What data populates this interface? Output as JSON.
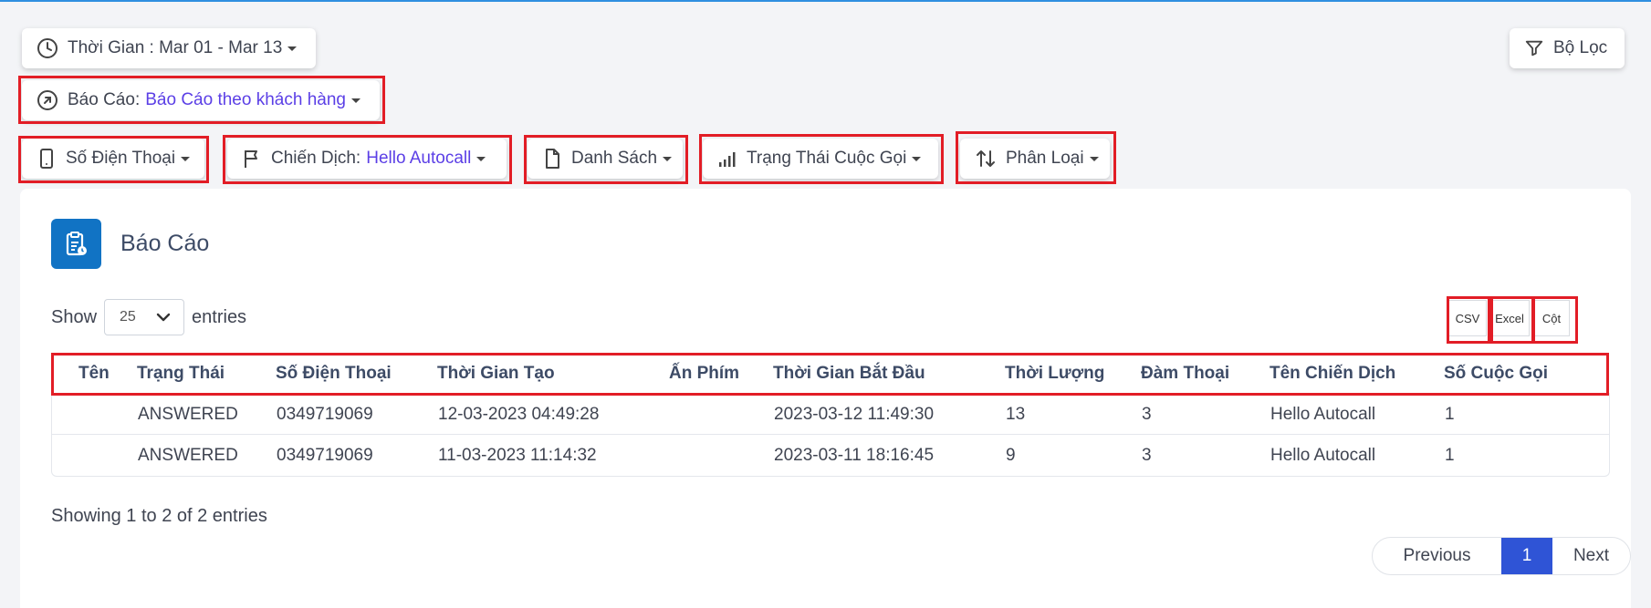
{
  "filters": {
    "time": {
      "label": "Thời Gian : Mar 01 - Mar 13"
    },
    "report": {
      "label": "Báo Cáo:",
      "value": "Báo Cáo theo khách hàng"
    },
    "phone": {
      "label": "Số Điện Thoại"
    },
    "campaign": {
      "label": "Chiến Dịch:",
      "value": "Hello Autocall"
    },
    "list": {
      "label": "Danh Sách"
    },
    "call_status": {
      "label": "Trạng Thái Cuộc Gọi"
    },
    "category": {
      "label": "Phân Loại"
    },
    "filter_button": {
      "label": "Bộ Lọc"
    }
  },
  "report": {
    "title": "Báo Cáo",
    "show_label": "Show",
    "page_size": "25",
    "entries_label": "entries",
    "export": {
      "csv": "CSV",
      "excel": "Excel",
      "columns": "Cột"
    },
    "columns": [
      "Tên",
      "Trạng Thái",
      "Số Điện Thoại",
      "Thời Gian Tạo",
      "Ấn Phím",
      "Thời Gian Bắt Đầu",
      "Thời Lượng",
      "Đàm Thoại",
      "Tên Chiến Dịch",
      "Số Cuộc Gọi"
    ],
    "rows": [
      [
        "",
        "ANSWERED",
        "0349719069",
        "12-03-2023 04:49:28",
        "",
        "2023-03-12 11:49:30",
        "13",
        "3",
        "Hello Autocall",
        "1"
      ],
      [
        "",
        "ANSWERED",
        "0349719069",
        "11-03-2023 11:14:32",
        "",
        "2023-03-11 18:16:45",
        "9",
        "3",
        "Hello Autocall",
        "1"
      ]
    ],
    "info": "Showing 1 to 2 of 2 entries",
    "pagination": {
      "previous": "Previous",
      "current": "1",
      "next": "Next"
    }
  },
  "colors": {
    "accent": "#5b3fe6",
    "highlight": "#e21d26",
    "primary": "#1173c4",
    "pager_active": "#2f54d6"
  }
}
